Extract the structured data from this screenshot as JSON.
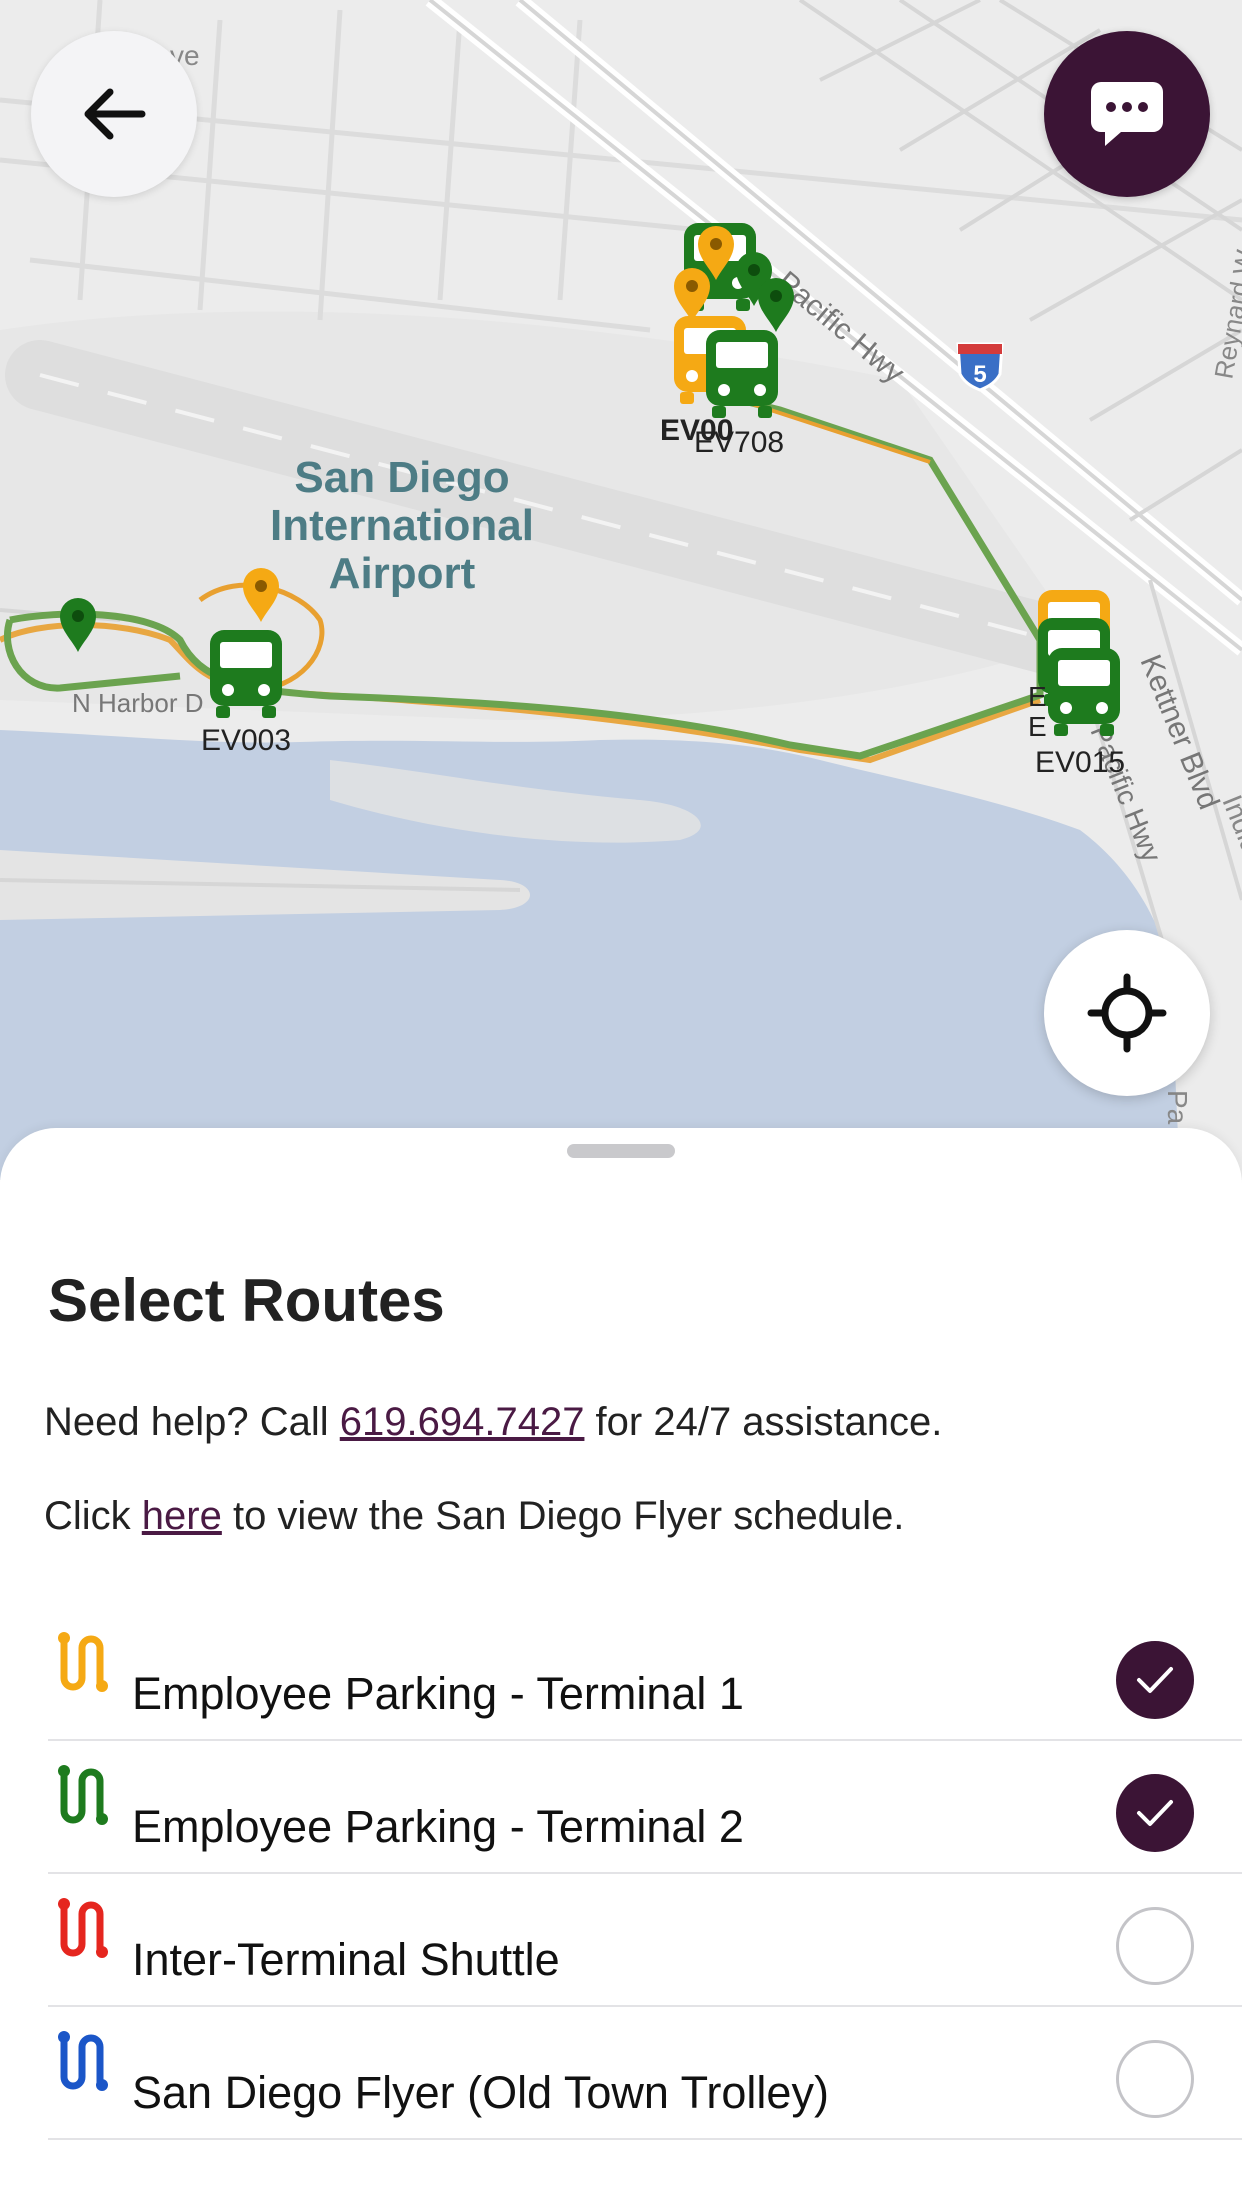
{
  "map": {
    "place_label": [
      "San Diego",
      "International",
      "Airport"
    ],
    "street_labels": {
      "pacific_hwy": "Pacific Hwy",
      "n_harbor": "N Harbor D",
      "kettner": "Kettner Blvd",
      "reynard": "Reynard W",
      "pacific_hwy_2": "Pacific Hwy",
      "partial_ave": "ve",
      "partial_pa": "Pa",
      "partial_ind": "India"
    },
    "highway_shield": "5",
    "vehicles": [
      {
        "id": "EV003",
        "color": "#1e7b1e"
      },
      {
        "id": "EV015",
        "color": "#1e7b1e"
      },
      {
        "id": "EV708",
        "color": "#1e7b1e"
      }
    ],
    "overlapping_labels": [
      "EV00",
      "EV708",
      "E",
      "E",
      "EV015"
    ],
    "colors": {
      "route_green": "#6ba34f",
      "route_orange": "#e8a030",
      "vehicle_green": "#1e7b1e",
      "vehicle_orange": "#f5a914",
      "water": "#c2cfe2",
      "land": "#ececec"
    }
  },
  "buttons": {
    "back_icon": "arrow-left-icon",
    "chat_icon": "chat-bubble-icon",
    "locate_icon": "crosshair-icon"
  },
  "sheet": {
    "title": "Select Routes",
    "help_prefix": "Need help? Call ",
    "phone": "619.694.7427",
    "help_suffix": " for 24/7 assistance.",
    "schedule_prefix": "Click ",
    "schedule_link": "here",
    "schedule_suffix": " to view the San Diego Flyer schedule."
  },
  "routes": [
    {
      "label": "Employee Parking - Terminal 1",
      "color": "#f5a914",
      "selected": true
    },
    {
      "label": "Employee Parking - Terminal 2",
      "color": "#1e7b1e",
      "selected": true
    },
    {
      "label": "Inter-Terminal Shuttle",
      "color": "#e5261f",
      "selected": false
    },
    {
      "label": "San Diego Flyer (Old Town Trolley)",
      "color": "#1b56c8",
      "selected": false
    }
  ]
}
